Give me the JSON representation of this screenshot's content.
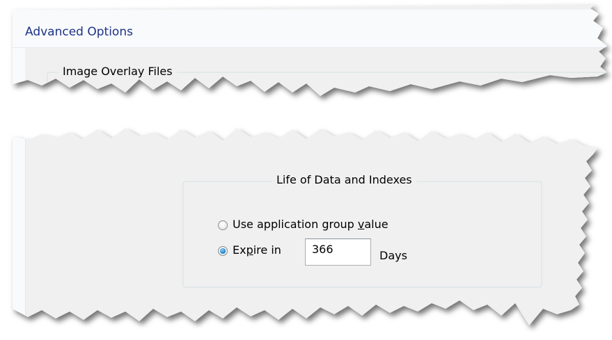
{
  "window": {
    "title": "Advanced Options"
  },
  "image_overlay_group": {
    "label": "Image Overlay Files"
  },
  "life_group": {
    "label": "Life of Data and Indexes",
    "option_app_group": {
      "prefix": "Use application group ",
      "mnemonic": "v",
      "suffix": "alue",
      "selected": false
    },
    "option_expire": {
      "prefix": "Ex",
      "mnemonic": "p",
      "suffix": "ire in",
      "selected": true
    },
    "expire_days_value": "366",
    "days_label": "Days"
  }
}
